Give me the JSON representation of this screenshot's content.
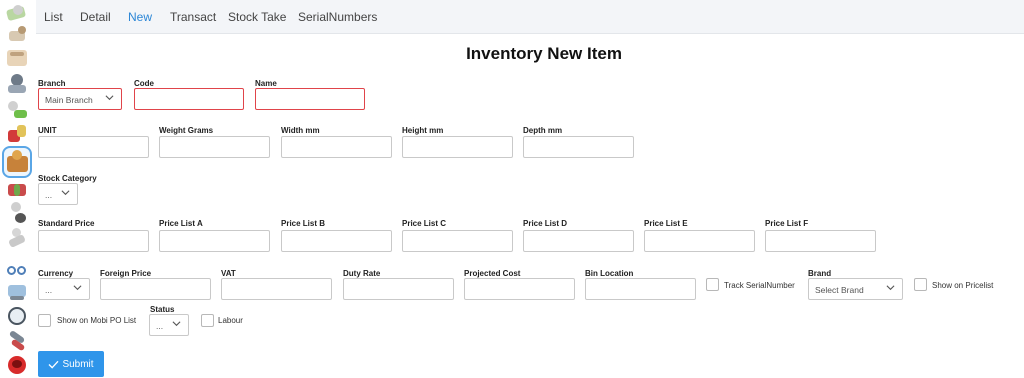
{
  "nav": {
    "tabs": [
      {
        "label": "List",
        "active": false
      },
      {
        "label": "Detail",
        "active": false
      },
      {
        "label": "New",
        "active": true
      },
      {
        "label": "Transact",
        "active": false
      },
      {
        "label": "Stock Take",
        "active": false
      },
      {
        "label": "SerialNumbers",
        "active": false
      }
    ]
  },
  "sidebar": {
    "icons": [
      "money-icon",
      "dog-icon",
      "people-icon",
      "stamp-icon",
      "person-cash-icon",
      "gift-icon",
      "inventory-icon",
      "books-icon",
      "person-tools-icon",
      "runner-icon",
      "cyclist-icon",
      "worker-computer-icon",
      "clock-icon",
      "tools-icon",
      "fire-icon"
    ],
    "active_icon": "inventory-icon"
  },
  "form": {
    "title": "Inventory New Item",
    "branch": {
      "label": "Branch",
      "value": "Main Branch"
    },
    "code": {
      "label": "Code",
      "value": ""
    },
    "name": {
      "label": "Name",
      "value": ""
    },
    "unit": {
      "label": "UNIT",
      "value": ""
    },
    "weight": {
      "label": "Weight Grams",
      "value": ""
    },
    "width": {
      "label": "Width mm",
      "value": ""
    },
    "height": {
      "label": "Height mm",
      "value": ""
    },
    "depth": {
      "label": "Depth mm",
      "value": ""
    },
    "stock_category": {
      "label": "Stock Category",
      "value": "..."
    },
    "standard_price": {
      "label": "Standard Price",
      "value": ""
    },
    "price_a": {
      "label": "Price List A",
      "value": ""
    },
    "price_b": {
      "label": "Price List B",
      "value": ""
    },
    "price_c": {
      "label": "Price List C",
      "value": ""
    },
    "price_d": {
      "label": "Price List D",
      "value": ""
    },
    "price_e": {
      "label": "Price List E",
      "value": ""
    },
    "price_f": {
      "label": "Price List F",
      "value": ""
    },
    "currency": {
      "label": "Currency",
      "value": "..."
    },
    "foreign_price": {
      "label": "Foreign Price",
      "value": ""
    },
    "vat": {
      "label": "VAT",
      "value": ""
    },
    "duty_rate": {
      "label": "Duty Rate",
      "value": ""
    },
    "projected_cost": {
      "label": "Projected Cost",
      "value": ""
    },
    "bin_location": {
      "label": "Bin Location",
      "value": ""
    },
    "track_serial": {
      "label": "Track SerialNumber",
      "checked": false
    },
    "brand": {
      "label": "Brand",
      "value": "Select Brand"
    },
    "show_pricelist": {
      "label": "Show on Pricelist",
      "checked": false
    },
    "show_mobi": {
      "label": "Show on Mobi PO List",
      "checked": false
    },
    "status": {
      "label": "Status",
      "value": "..."
    },
    "labour": {
      "label": "Labour",
      "checked": false
    },
    "submit_label": "Submit"
  },
  "colors": {
    "accent": "#2f95ea",
    "error_border": "#e0444a",
    "active_tab": "#2b86d6"
  }
}
